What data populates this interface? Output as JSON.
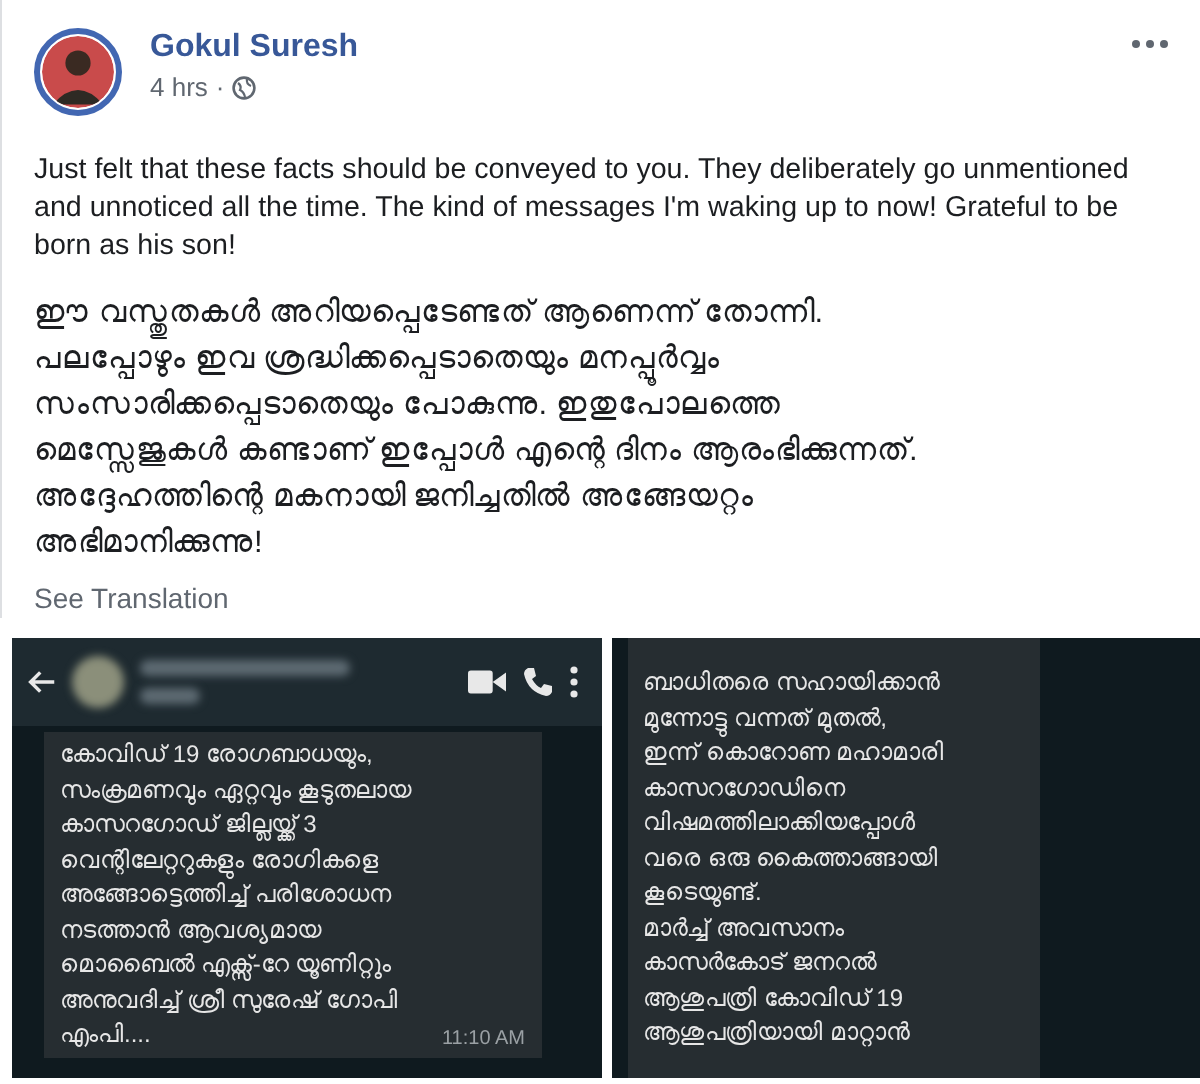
{
  "post": {
    "author": "Gokul Suresh",
    "time": "4 hrs",
    "separator": "·",
    "text": "Just felt that these facts should be conveyed to you. They deliberately go unmentioned and unnoticed all the time. The kind of messages I'm waking up to now! Grateful to be born as his son!",
    "text_ml": [
      "ഈ വസ്തുതകൾ അറിയപ്പെടേണ്ടത് ആണെന്ന് തോന്നി.",
      "പലപ്പോഴും ഇവ ശ്രദ്ധിക്കപ്പെടാതെയും മനപ്പൂർവ്വം",
      "സംസാരിക്കപ്പെടാതെയും പോകുന്നു. ഇതുപോലത്തെ",
      "മെസ്സേജുകൾ കണ്ടാണ് ഇപ്പോൾ എന്റെ ദിനം ആരംഭിക്കുന്നത്.",
      "അദ്ദേഹത്തിന്റെ മകനായി ജനിച്ചതിൽ അങ്ങേയറ്റം",
      "അഭിമാനിക്കുന്നു!"
    ],
    "see_translation": "See Translation"
  },
  "screenshots": [
    {
      "kind": "chat_header",
      "message": [
        "കോവിഡ് 19 രോഗബാധയും,",
        "സംക്രമണവും ഏറ്റവും കൂടുതലായ",
        "കാസറഗോഡ് ജില്ലയ്ക്ക് 3",
        "വെന്റിലേറ്ററുകളും രോഗികളെ",
        "അങ്ങോട്ടെത്തിച്ച് പരിശോധന",
        "നടത്താൻ ആവശ്യമായ",
        "മൊബൈൽ എക്സ്-റേ യൂണിറ്റും",
        "അനുവദിച്ച് ശ്രീ സുരേഷ് ഗോപി",
        "എംപി...."
      ],
      "time": "11:10 AM"
    },
    {
      "kind": "message_only",
      "message": [
        "ബാധിതരെ സഹായിക്കാൻ",
        "മുന്നോട്ടു വന്നത് മുതൽ,",
        "ഇന്ന് കൊറോണ മഹാമാരി",
        "കാസറഗോഡിനെ",
        "വിഷമത്തിലാക്കിയപ്പോൾ",
        "വരെ ഒരു കൈത്താങ്ങായി",
        "കൂടെയുണ്ട്.",
        "മാർച്ച് അവസാനം",
        "കാസർകോട് ജനറൽ",
        "ആശുപത്രി  കോവിഡ് 19",
        "ആശുപത്രിയായി മാറ്റാൻ"
      ]
    }
  ]
}
